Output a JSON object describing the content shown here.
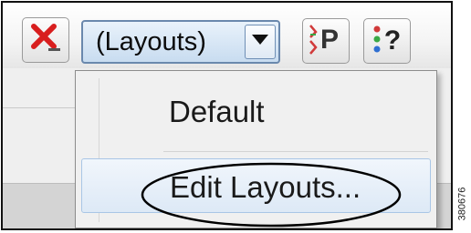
{
  "toolbar": {
    "close_icon": "red-x-close-icon",
    "layouts_combo": {
      "value": "(Layouts)",
      "arrow_icon": "chevron-down-icon"
    },
    "properties_icon": "properties-icon",
    "properties_glyph": "P",
    "help_icon": "help-icon",
    "help_glyph": "?"
  },
  "menu": {
    "items": [
      {
        "label": "Default"
      },
      {
        "label": "Edit Layouts..."
      }
    ]
  },
  "figure_number": "380676",
  "colors": {
    "close_red": "#d81e1e",
    "combo_blue": "#c8dcf0",
    "highlight_blue": "#dde9f6"
  }
}
